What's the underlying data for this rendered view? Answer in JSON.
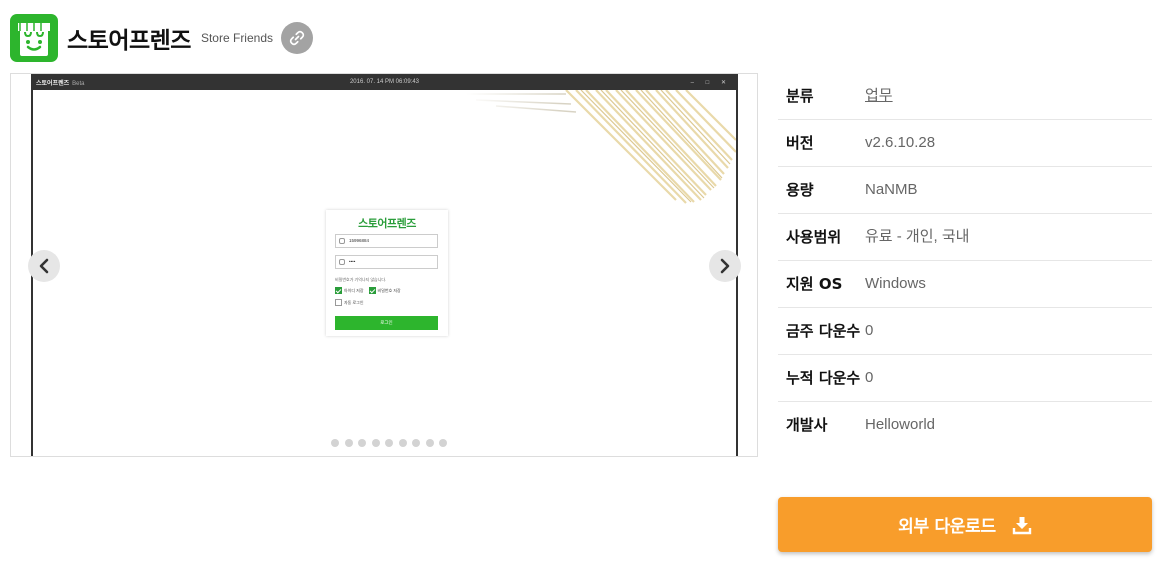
{
  "header": {
    "title": "스토어프렌즈",
    "subtitle": "Store Friends",
    "icon": "store-icon",
    "link_icon": "link-icon"
  },
  "gallery": {
    "screenshot": {
      "window_title": "스토어프렌즈",
      "window_suffix": "Beta",
      "datetime": "2016. 07. 14 PM 06:09:43",
      "window_controls": "– □ ✕",
      "login": {
        "logo": "스토어프렌즈",
        "id_value": "15996884",
        "pw_value": "••••",
        "note": "비밀번호가 기억나지 않습니다.",
        "save_id": "아이디 저장",
        "save_pw": "비밀번호 저장",
        "auto_login": "자동 로그인",
        "login_button": "로그인"
      }
    },
    "prev_icon": "chevron-left-icon",
    "next_icon": "chevron-right-icon",
    "dot_count": 9
  },
  "info": [
    {
      "key": "분류",
      "value": "업무",
      "link": true
    },
    {
      "key": "버전",
      "value": "v2.6.10.28"
    },
    {
      "key": "용량",
      "value": "NaNMB"
    },
    {
      "key": "사용범위",
      "value": "유료 - 개인, 국내"
    },
    {
      "key": "지원 OS",
      "value": "Windows"
    },
    {
      "key": "금주 다운수",
      "value": "0"
    },
    {
      "key": "누적 다운수",
      "value": "0"
    },
    {
      "key": "개발사",
      "value": "Helloworld"
    }
  ],
  "download": {
    "label": "외부 다운로드",
    "icon": "download-icon"
  },
  "colors": {
    "accent": "#f89d2b",
    "brand_green": "#2db52d"
  }
}
